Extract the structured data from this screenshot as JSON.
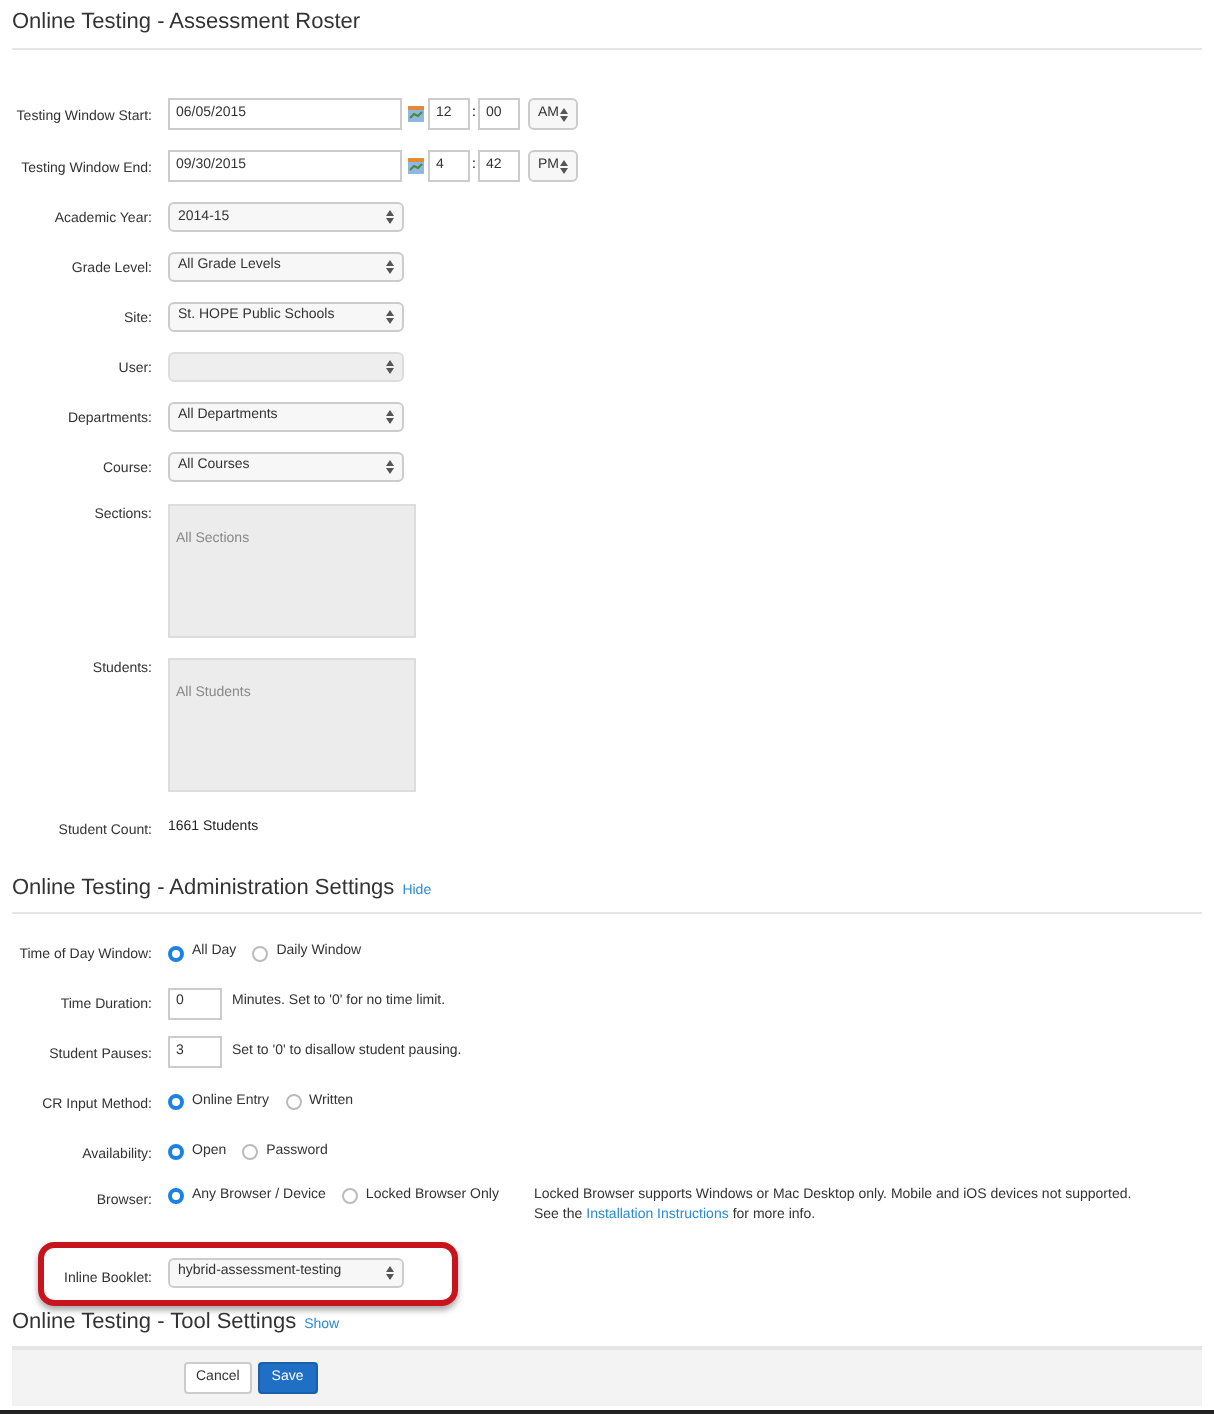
{
  "roster": {
    "title": "Online Testing - Assessment Roster",
    "date_rows": [
      {
        "label": "Testing Window Start:",
        "date": "06/05/2015",
        "hour": "12",
        "separator": ":",
        "minute": "00",
        "ampm": "AM"
      },
      {
        "label": "Testing Window End:",
        "date": "09/30/2015",
        "hour": "4",
        "separator": ":",
        "minute": "42",
        "ampm": "PM"
      }
    ],
    "selects": [
      {
        "label": "Academic Year:",
        "value": "2014-15",
        "disabled": false
      },
      {
        "label": "Grade Level:",
        "value": "All Grade Levels",
        "disabled": false
      },
      {
        "label": "Site:",
        "value": "St. HOPE Public Schools",
        "disabled": false
      },
      {
        "label": "User:",
        "disabled": true
      },
      {
        "label": "Departments:",
        "value": "All Departments",
        "disabled": false
      },
      {
        "label": "Course:",
        "value": "All Courses",
        "disabled": false
      }
    ],
    "list_boxes": [
      {
        "label": "Sections:",
        "placeholder": "All Sections"
      },
      {
        "label": "Students:",
        "placeholder": "All Students"
      }
    ],
    "count": {
      "label": "Student Count:",
      "value": "1661 Students"
    }
  },
  "admin": {
    "title": "Online Testing - Administration Settings",
    "toggle": "Hide",
    "rows": [
      {
        "kind": "radio",
        "label": "Time of Day Window:",
        "options": [
          {
            "label": "All Day",
            "selected": true
          },
          {
            "label": "Daily Window",
            "selected": false
          }
        ]
      },
      {
        "kind": "number",
        "label": "Time Duration:",
        "value": "0",
        "hint": "Minutes.  Set to '0' for no time limit."
      },
      {
        "kind": "number",
        "label": "Student Pauses:",
        "value": "3",
        "hint": "Set to '0' to disallow student pausing."
      },
      {
        "kind": "radio",
        "label": "CR Input Method:",
        "options": [
          {
            "label": "Online Entry",
            "selected": true
          },
          {
            "label": "Written",
            "selected": false
          }
        ]
      },
      {
        "kind": "radio",
        "label": "Availability:",
        "options": [
          {
            "label": "Open",
            "selected": true
          },
          {
            "label": "Password",
            "selected": false
          }
        ]
      },
      {
        "kind": "radio",
        "label": "Browser:",
        "options": [
          {
            "label": "Any Browser / Device",
            "selected": true
          },
          {
            "label": "Locked Browser Only",
            "selected": false
          }
        ],
        "note": {
          "line1": "Locked Browser supports Windows or Mac Desktop only. Mobile and iOS devices not supported.",
          "prefix": "See the",
          "link": "Installation Instructions",
          "suffix": "for more info."
        }
      }
    ],
    "booklet": {
      "label": "Inline Booklet:",
      "value": "hybrid-assessment-testing",
      "highlighted": true
    }
  },
  "tools": {
    "title": "Online Testing - Tool Settings",
    "toggle": "Show"
  },
  "buttons": {
    "cancel": "Cancel",
    "save": "Save"
  }
}
